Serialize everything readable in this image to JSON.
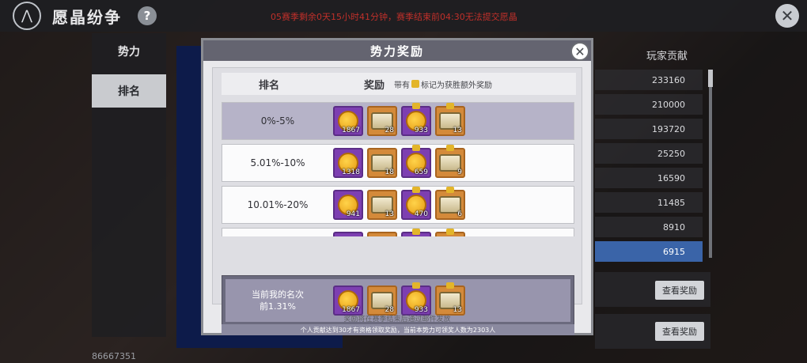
{
  "header": {
    "title": "愿晶纷争",
    "help_label": "?",
    "season_notice": "05赛季剩余0天15小时41分钟，赛季结束前04:30无法提交愿晶",
    "close_label": "✕"
  },
  "side_tabs": [
    {
      "label": "势力"
    },
    {
      "label": "排名"
    }
  ],
  "rank_panel": {
    "header": "玩家贡献",
    "values": [
      "233160",
      "210000",
      "193720",
      "25250",
      "16590",
      "11485",
      "8910",
      "6915"
    ],
    "view_buttons": [
      "查看奖励",
      "查看奖励"
    ]
  },
  "player_id": "86667351",
  "modal": {
    "title": "势力奖励",
    "close_label": "✕",
    "col_rank": "排名",
    "col_reward": "奖励",
    "col_note_pre": "带有",
    "col_note_post": "标记为获胜额外奖励",
    "rows": [
      {
        "label": "0%-5%",
        "items": [
          {
            "kind": "coin",
            "frame": "purple",
            "qty": "1867",
            "bonus": false
          },
          {
            "kind": "chest",
            "frame": "orange",
            "qty": "28",
            "bonus": false
          },
          {
            "kind": "coin",
            "frame": "purple",
            "qty": "933",
            "bonus": true
          },
          {
            "kind": "chest",
            "frame": "orange",
            "qty": "13",
            "bonus": true
          }
        ]
      },
      {
        "label": "5.01%-10%",
        "items": [
          {
            "kind": "coin",
            "frame": "purple",
            "qty": "1318",
            "bonus": false
          },
          {
            "kind": "chest",
            "frame": "orange",
            "qty": "18",
            "bonus": false
          },
          {
            "kind": "coin",
            "frame": "purple",
            "qty": "659",
            "bonus": true
          },
          {
            "kind": "chest",
            "frame": "orange",
            "qty": "9",
            "bonus": true
          }
        ]
      },
      {
        "label": "10.01%-20%",
        "items": [
          {
            "kind": "coin",
            "frame": "purple",
            "qty": "941",
            "bonus": false
          },
          {
            "kind": "chest",
            "frame": "orange",
            "qty": "13",
            "bonus": false
          },
          {
            "kind": "coin",
            "frame": "purple",
            "qty": "470",
            "bonus": true
          },
          {
            "kind": "chest",
            "frame": "orange",
            "qty": "6",
            "bonus": true
          }
        ]
      },
      {
        "label": "",
        "items": [
          {
            "kind": "coin",
            "frame": "purple",
            "qty": "",
            "bonus": false
          },
          {
            "kind": "chest",
            "frame": "orange",
            "qty": "",
            "bonus": false
          },
          {
            "kind": "coin",
            "frame": "purple",
            "qty": "",
            "bonus": true
          },
          {
            "kind": "chest",
            "frame": "orange",
            "qty": "",
            "bonus": true
          }
        ]
      }
    ],
    "my_rank_line1": "当前我的名次",
    "my_rank_line2": "前1.31%",
    "my_items": [
      {
        "kind": "coin",
        "frame": "purple",
        "qty": "1867",
        "bonus": false
      },
      {
        "kind": "chest",
        "frame": "orange",
        "qty": "28",
        "bonus": false
      },
      {
        "kind": "coin",
        "frame": "purple",
        "qty": "933",
        "bonus": true
      },
      {
        "kind": "chest",
        "frame": "orange",
        "qty": "13",
        "bonus": true
      }
    ],
    "eligibility_note": "个人贡献达到30才有资格领取奖励，当前本势力可领奖人数为2303人",
    "mail_note": "奖励将在赛季结束后通过邮件发放"
  }
}
